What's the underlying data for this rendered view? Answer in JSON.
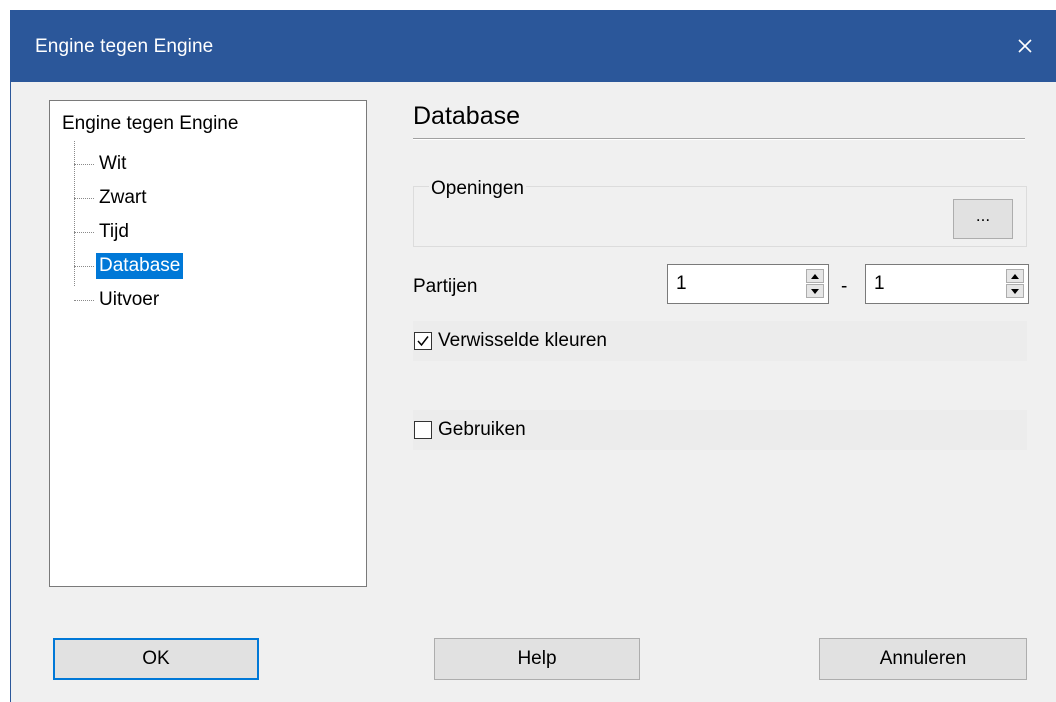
{
  "window": {
    "title": "Engine tegen Engine",
    "accent_color": "#2b579a"
  },
  "tree": {
    "root": "Engine tegen Engine",
    "items": [
      {
        "label": "Wit"
      },
      {
        "label": "Zwart"
      },
      {
        "label": "Tijd"
      },
      {
        "label": "Database",
        "selected": true
      },
      {
        "label": "Uitvoer"
      }
    ],
    "selection_color": "#0078d7"
  },
  "section": {
    "title": "Database"
  },
  "openingen": {
    "group_label": "Openingen",
    "browse_label": "..."
  },
  "partijen": {
    "label": "Partijen",
    "from_value": "1",
    "separator": "-",
    "to_value": "1"
  },
  "options": {
    "swap_colors": {
      "label": "Verwisselde kleuren",
      "checked": true
    },
    "use": {
      "label": "Gebruiken",
      "checked": false
    }
  },
  "buttons": {
    "ok": "OK",
    "help": "Help",
    "cancel": "Annuleren"
  },
  "icons": {
    "close": "close-icon",
    "spin_up": "arrow-up-icon",
    "spin_down": "arrow-down-icon",
    "check": "checkmark-icon"
  }
}
